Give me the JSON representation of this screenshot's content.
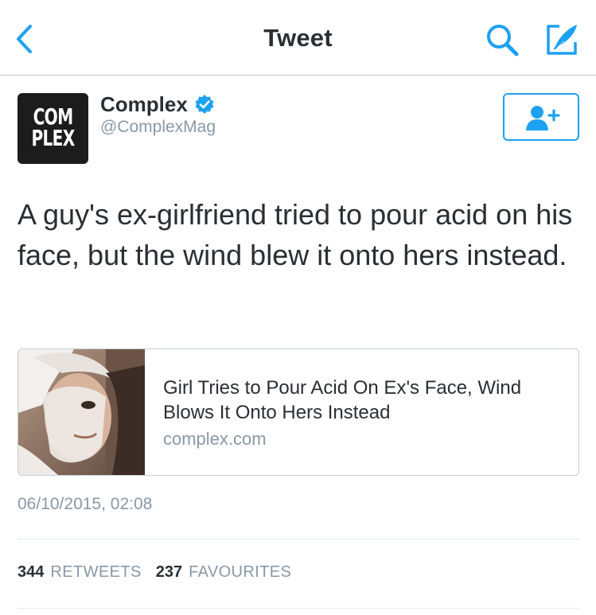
{
  "navbar": {
    "title": "Tweet",
    "back_icon": "chevron-left-icon",
    "search_icon": "search-icon",
    "compose_icon": "compose-feather-icon",
    "accent_color": "#1da1f2"
  },
  "author": {
    "avatar_text": "COM\nPLEX",
    "display_name": "Complex",
    "handle": "@ComplexMag",
    "verified": true,
    "verified_icon": "verified-badge-icon"
  },
  "follow_button": {
    "icon": "follow-user-plus-icon"
  },
  "tweet": {
    "text": "A guy's ex-girlfriend tried to pour acid on his face, but the wind blew it onto hers instead."
  },
  "link_card": {
    "title": "Girl Tries to Pour Acid On Ex's Face, Wind Blows It Onto Hers Instead",
    "domain": "complex.com"
  },
  "timestamp": "06/10/2015, 02:08",
  "stats": {
    "retweets_count": "344",
    "retweets_label": "RETWEETS",
    "favourites_count": "237",
    "favourites_label": "FAVOURITES"
  }
}
